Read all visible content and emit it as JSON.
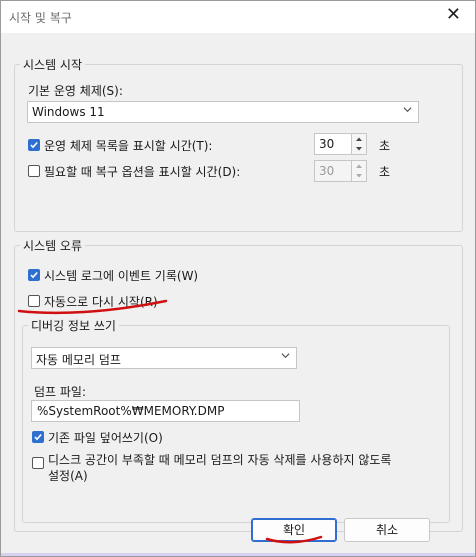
{
  "window": {
    "title": "시작 및 복구",
    "close_glyph": "✕"
  },
  "system_startup": {
    "legend": "시스템 시작",
    "default_os_label": "기본 운영 체제(S):",
    "default_os_value": "Windows 11",
    "show_os_list": {
      "label": "운영 체제 목록을 표시할 시간(T):",
      "checked": true,
      "value": "30",
      "unit": "초"
    },
    "show_recovery": {
      "label": "필요할 때 복구 옵션을 표시할 시간(D):",
      "checked": false,
      "value": "30",
      "unit": "초"
    }
  },
  "system_failure": {
    "legend": "시스템 오류",
    "write_event": {
      "label": "시스템 로그에 이벤트 기록(W)",
      "checked": true
    },
    "auto_restart": {
      "label": "자동으로 다시 시작(R)",
      "checked": false
    },
    "debug": {
      "legend": "디버깅 정보 쓰기",
      "dump_type": "자동 메모리 덤프",
      "dump_file_label": "덤프 파일:",
      "dump_file_value": "%SystemRoot%₩MEMORY.DMP",
      "overwrite": {
        "label": "기존 파일 덮어쓰기(O)",
        "checked": true
      },
      "disable_auto_delete": {
        "label": "디스크 공간이 부족할 때 메모리 덤프의 자동 삭제를 사용하지 않도록 설정(A)",
        "label_line1": "디스크 공간이 부족할 때 메모리 덤프의 자동 삭제를 사용하지 않도록",
        "label_line2": "설정(A)",
        "checked": false
      }
    }
  },
  "buttons": {
    "ok": "확인",
    "cancel": "취소"
  },
  "colors": {
    "accent": "#2f6fd0",
    "annotation": "#d01010"
  },
  "icons": {
    "dropdown": "chevron-down-icon",
    "close": "close-icon",
    "check": "checkmark-icon"
  }
}
